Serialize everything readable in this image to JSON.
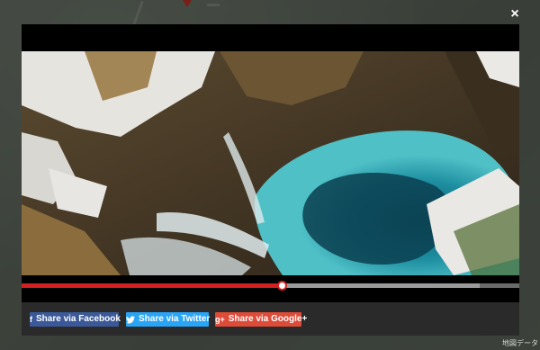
{
  "modal": {
    "close_icon": "×"
  },
  "video": {
    "progress_fraction": 0.523,
    "buffered_fraction": 0.92,
    "colors": {
      "played": "#d32020",
      "buffered": "#9a9a9a",
      "track": "#6a6a6a"
    }
  },
  "share": {
    "facebook": {
      "icon": "f",
      "label": "Share via Facebook",
      "color": "#3b5998"
    },
    "twitter": {
      "icon": "twitter-bird",
      "label": "Share via Twitter",
      "color": "#2aa4f4"
    },
    "googleplus": {
      "icon": "g+",
      "label": "Share via Google+",
      "color": "#dd4b39"
    }
  },
  "map": {
    "attribution": "地図データ"
  }
}
